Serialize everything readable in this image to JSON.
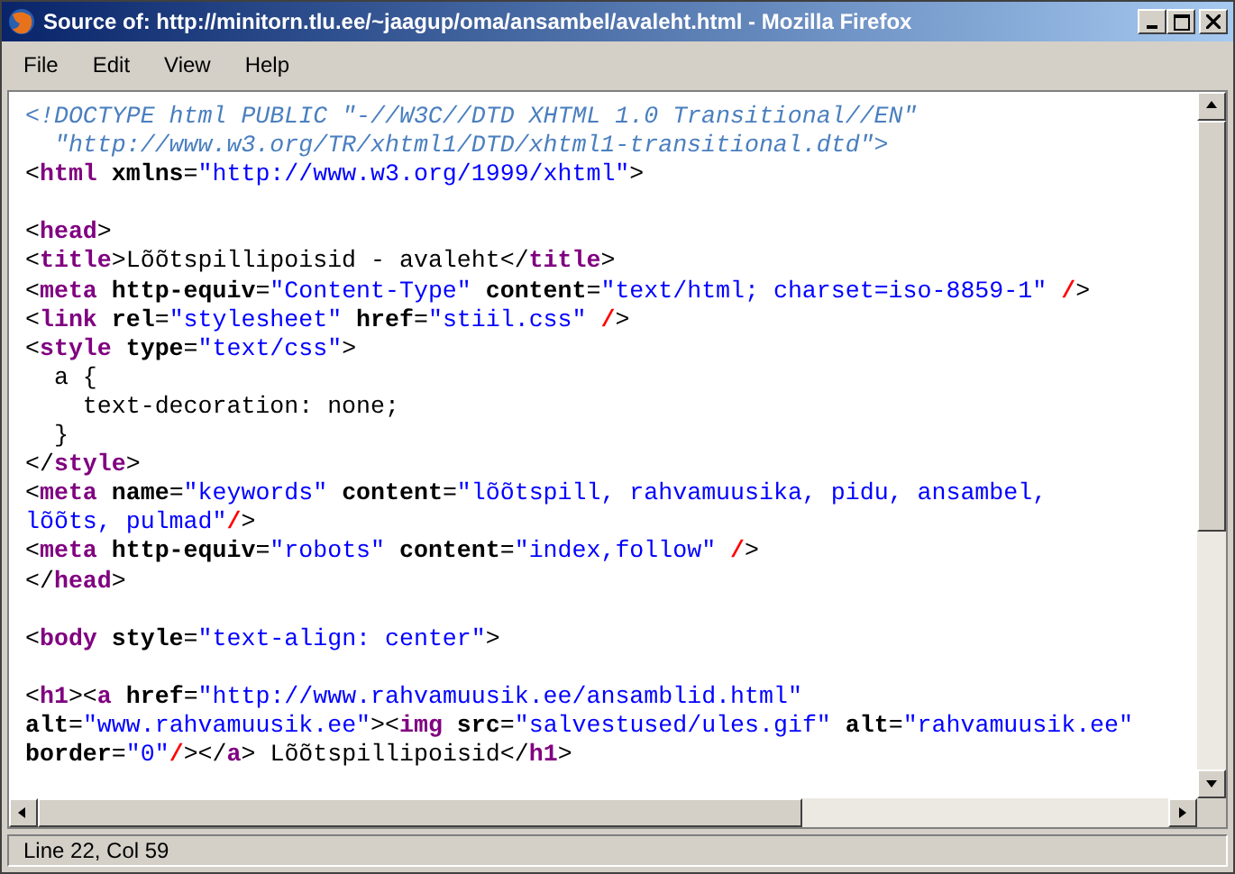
{
  "window": {
    "title": "Source of: http://minitorn.tlu.ee/~jaagup/oma/ansambel/avaleht.html - Mozilla Firefox"
  },
  "menu": [
    {
      "label": "File"
    },
    {
      "label": "Edit"
    },
    {
      "label": "View"
    },
    {
      "label": "Help"
    }
  ],
  "source_lines": [
    {
      "tokens": [
        {
          "kind": "doctype",
          "text": "<!DOCTYPE html PUBLIC \"-//W3C//DTD XHTML 1.0 Transitional//EN\""
        }
      ]
    },
    {
      "tokens": [
        {
          "kind": "doctype",
          "text": "  \"http://www.w3.org/TR/xhtml1/DTD/xhtml1-transitional.dtd\">"
        }
      ]
    },
    {
      "tokens": [
        {
          "kind": "punct",
          "text": "<"
        },
        {
          "kind": "tag",
          "text": "html"
        },
        {
          "kind": "attr",
          "text": " xmlns"
        },
        {
          "kind": "punct",
          "text": "="
        },
        {
          "kind": "value",
          "text": "\"http://www.w3.org/1999/xhtml\""
        },
        {
          "kind": "punct",
          "text": ">"
        }
      ]
    },
    {
      "blank_before": true,
      "tokens": [
        {
          "kind": "punct",
          "text": "<"
        },
        {
          "kind": "tag",
          "text": "head"
        },
        {
          "kind": "punct",
          "text": ">"
        }
      ]
    },
    {
      "tokens": [
        {
          "kind": "punct",
          "text": "<"
        },
        {
          "kind": "tag",
          "text": "title"
        },
        {
          "kind": "punct",
          "text": ">Lõõtspillipoisid - avaleht</"
        },
        {
          "kind": "tag",
          "text": "title"
        },
        {
          "kind": "punct",
          "text": ">"
        }
      ]
    },
    {
      "tokens": [
        {
          "kind": "punct",
          "text": "<"
        },
        {
          "kind": "tag",
          "text": "meta"
        },
        {
          "kind": "attr",
          "text": " http-equiv"
        },
        {
          "kind": "punct",
          "text": "="
        },
        {
          "kind": "value",
          "text": "\"Content-Type\""
        },
        {
          "kind": "attr",
          "text": " content"
        },
        {
          "kind": "punct",
          "text": "="
        },
        {
          "kind": "value",
          "text": "\"text/html; charset=iso-8859-1\""
        },
        {
          "kind": "slash",
          "text": " /"
        },
        {
          "kind": "punct",
          "text": ">"
        }
      ]
    },
    {
      "tokens": [
        {
          "kind": "punct",
          "text": "<"
        },
        {
          "kind": "tag",
          "text": "link"
        },
        {
          "kind": "attr",
          "text": " rel"
        },
        {
          "kind": "punct",
          "text": "="
        },
        {
          "kind": "value",
          "text": "\"stylesheet\""
        },
        {
          "kind": "attr",
          "text": " href"
        },
        {
          "kind": "punct",
          "text": "="
        },
        {
          "kind": "value",
          "text": "\"stiil.css\""
        },
        {
          "kind": "slash",
          "text": " /"
        },
        {
          "kind": "punct",
          "text": ">"
        }
      ]
    },
    {
      "tokens": [
        {
          "kind": "punct",
          "text": "<"
        },
        {
          "kind": "tag",
          "text": "style"
        },
        {
          "kind": "attr",
          "text": " type"
        },
        {
          "kind": "punct",
          "text": "="
        },
        {
          "kind": "value",
          "text": "\"text/css\""
        },
        {
          "kind": "punct",
          "text": ">"
        }
      ]
    },
    {
      "tokens": [
        {
          "kind": "punct",
          "text": "  a {"
        }
      ]
    },
    {
      "tokens": [
        {
          "kind": "punct",
          "text": "    text-decoration: none;"
        }
      ]
    },
    {
      "tokens": [
        {
          "kind": "punct",
          "text": "  }"
        }
      ]
    },
    {
      "tokens": [
        {
          "kind": "punct",
          "text": "</"
        },
        {
          "kind": "tag",
          "text": "style"
        },
        {
          "kind": "punct",
          "text": ">"
        }
      ]
    },
    {
      "tokens": [
        {
          "kind": "punct",
          "text": "<"
        },
        {
          "kind": "tag",
          "text": "meta"
        },
        {
          "kind": "attr",
          "text": " name"
        },
        {
          "kind": "punct",
          "text": "="
        },
        {
          "kind": "value",
          "text": "\"keywords\""
        },
        {
          "kind": "attr",
          "text": " content"
        },
        {
          "kind": "punct",
          "text": "="
        },
        {
          "kind": "value",
          "text": "\"lõõtspill, rahvamuusika, pidu, ansambel,"
        }
      ]
    },
    {
      "tokens": [
        {
          "kind": "value",
          "text": "lõõts, pulmad\""
        },
        {
          "kind": "slash",
          "text": "/"
        },
        {
          "kind": "punct",
          "text": ">"
        }
      ]
    },
    {
      "tokens": [
        {
          "kind": "punct",
          "text": "<"
        },
        {
          "kind": "tag",
          "text": "meta"
        },
        {
          "kind": "attr",
          "text": " http-equiv"
        },
        {
          "kind": "punct",
          "text": "="
        },
        {
          "kind": "value",
          "text": "\"robots\""
        },
        {
          "kind": "attr",
          "text": " content"
        },
        {
          "kind": "punct",
          "text": "="
        },
        {
          "kind": "value",
          "text": "\"index,follow\""
        },
        {
          "kind": "slash",
          "text": " /"
        },
        {
          "kind": "punct",
          "text": ">"
        }
      ]
    },
    {
      "tokens": [
        {
          "kind": "punct",
          "text": "</"
        },
        {
          "kind": "tag",
          "text": "head"
        },
        {
          "kind": "punct",
          "text": ">"
        }
      ]
    },
    {
      "blank_before": true,
      "tokens": [
        {
          "kind": "punct",
          "text": "<"
        },
        {
          "kind": "tag",
          "text": "body"
        },
        {
          "kind": "attr",
          "text": " style"
        },
        {
          "kind": "punct",
          "text": "="
        },
        {
          "kind": "value",
          "text": "\"text-align: center\""
        },
        {
          "kind": "punct",
          "text": ">"
        }
      ]
    },
    {
      "blank_before": true,
      "tokens": [
        {
          "kind": "punct",
          "text": "<"
        },
        {
          "kind": "tag",
          "text": "h1"
        },
        {
          "kind": "punct",
          "text": "><"
        },
        {
          "kind": "tag",
          "text": "a"
        },
        {
          "kind": "attr",
          "text": " href"
        },
        {
          "kind": "punct",
          "text": "="
        },
        {
          "kind": "value",
          "text": "\"http://www.rahvamuusik.ee/ansamblid.html\""
        }
      ]
    },
    {
      "tokens": [
        {
          "kind": "attr",
          "text": "alt"
        },
        {
          "kind": "punct",
          "text": "="
        },
        {
          "kind": "value",
          "text": "\"www.rahvamuusik.ee\""
        },
        {
          "kind": "punct",
          "text": "><"
        },
        {
          "kind": "tag",
          "text": "img"
        },
        {
          "kind": "attr",
          "text": " src"
        },
        {
          "kind": "punct",
          "text": "="
        },
        {
          "kind": "value",
          "text": "\"salvestused/ules.gif\""
        },
        {
          "kind": "attr",
          "text": " alt"
        },
        {
          "kind": "punct",
          "text": "="
        },
        {
          "kind": "value",
          "text": "\"rahvamuusik.ee\""
        }
      ]
    },
    {
      "tokens": [
        {
          "kind": "attr",
          "text": "border"
        },
        {
          "kind": "punct",
          "text": "="
        },
        {
          "kind": "value",
          "text": "\"0\""
        },
        {
          "kind": "slash",
          "text": "/"
        },
        {
          "kind": "punct",
          "text": "></"
        },
        {
          "kind": "tag",
          "text": "a"
        },
        {
          "kind": "punct",
          "text": "> Lõõtspillipoisid</"
        },
        {
          "kind": "tag",
          "text": "h1"
        },
        {
          "kind": "punct",
          "text": ">"
        }
      ]
    }
  ],
  "status_bar": {
    "text": "Line 22, Col 59"
  }
}
